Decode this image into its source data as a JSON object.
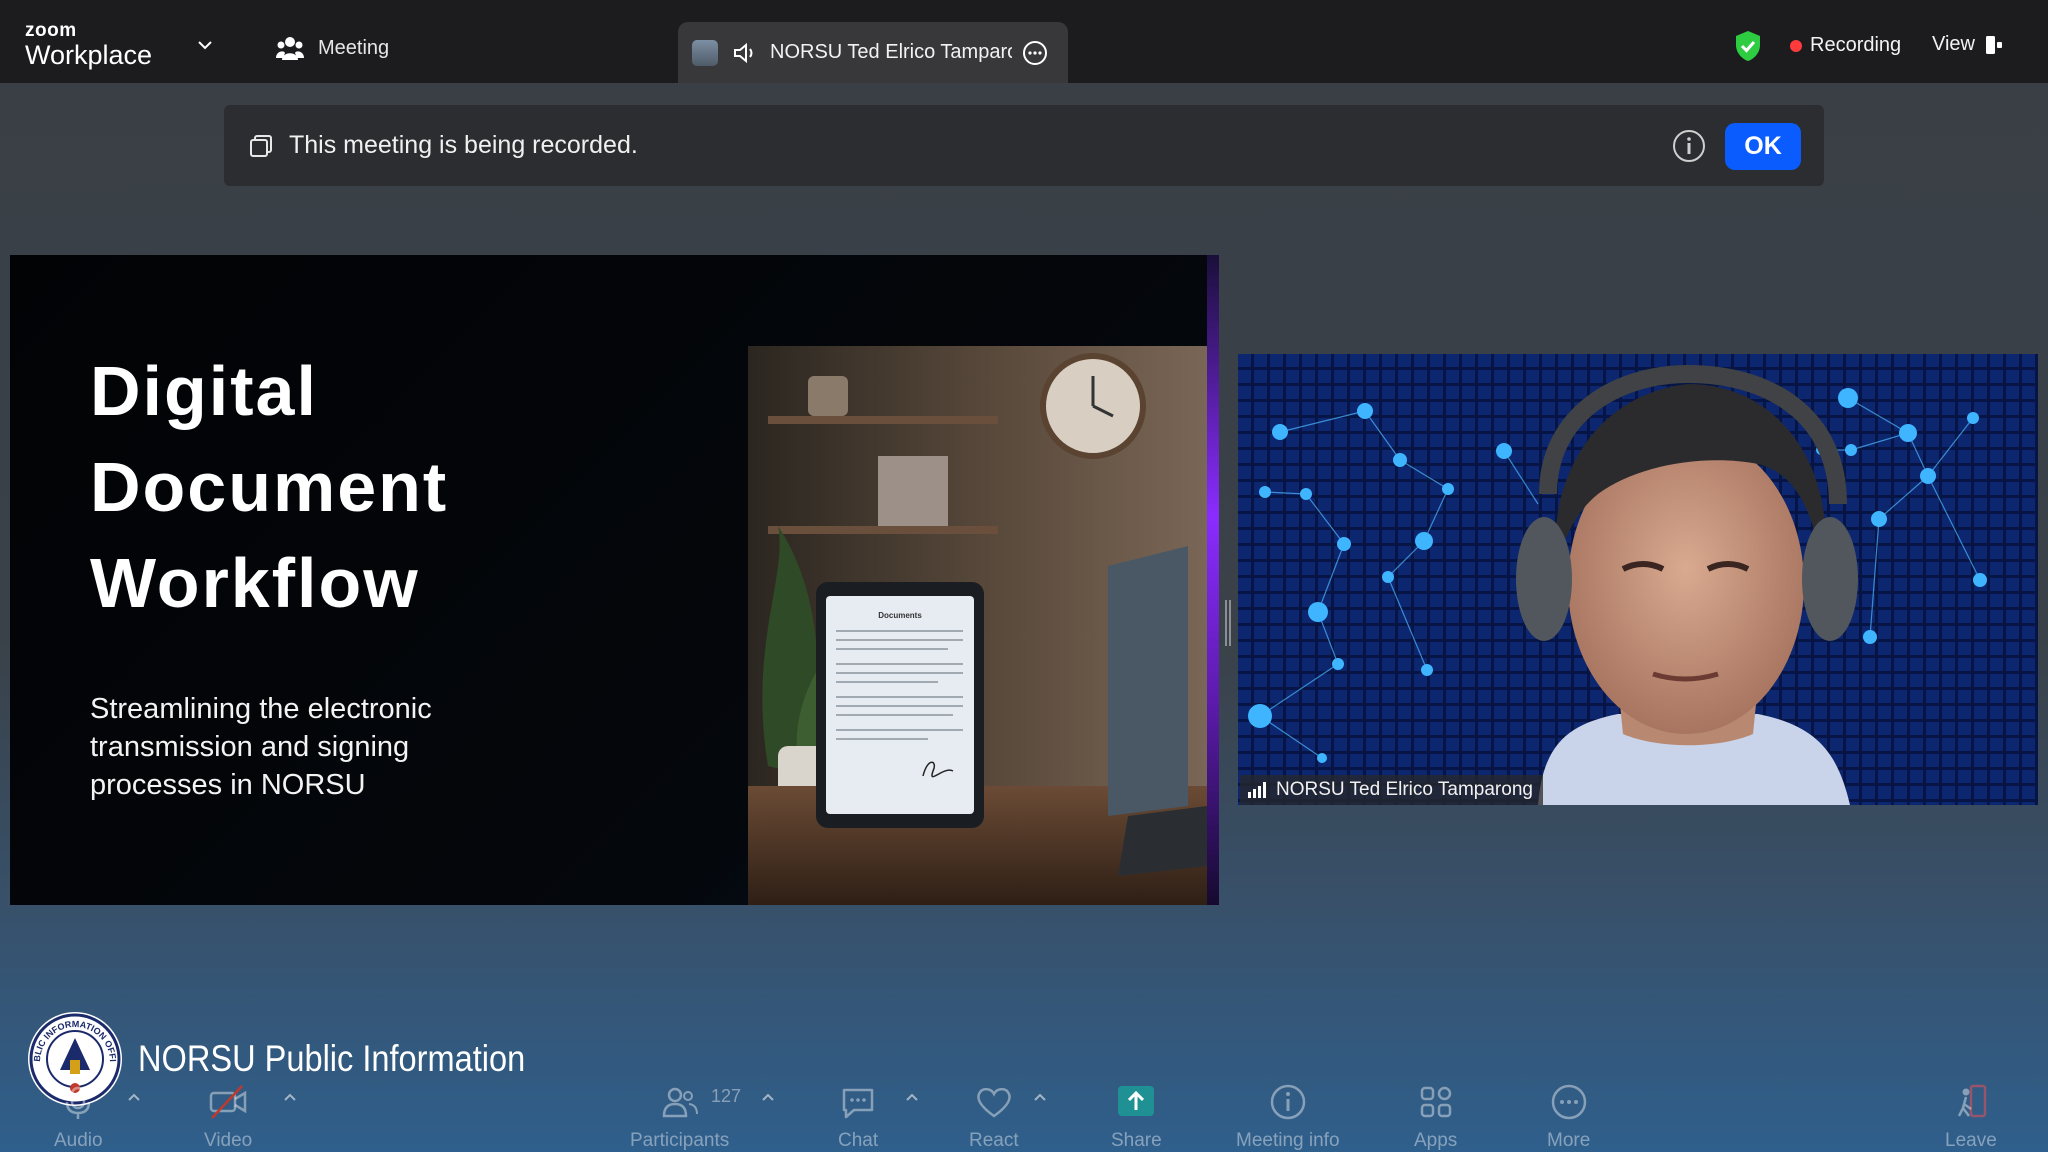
{
  "app": {
    "logo_top": "zoom",
    "logo_bottom": "Workplace"
  },
  "topbar": {
    "meeting_label": "Meeting",
    "speaker_name": "NORSU Ted Elrico Tamparong",
    "recording_label": "Recording",
    "view_label": "View"
  },
  "banner": {
    "message": "This meeting is being recorded.",
    "ok_label": "OK"
  },
  "slide": {
    "title_lines": [
      "Digital",
      "Document",
      "Workflow"
    ],
    "subtitle": "Streamlining the electronic transmission and signing processes in NORSU",
    "document_heading": "Documents"
  },
  "video": {
    "participant_name": "NORSU Ted Elrico Tamparong"
  },
  "organization": {
    "name": "NORSU Public Information",
    "seal_text": "PUBLIC INFORMATION OFFICE"
  },
  "toolbar": {
    "audio": "Audio",
    "video": "Video",
    "participants": "Participants",
    "participants_count": "127",
    "chat": "Chat",
    "react": "React",
    "share": "Share",
    "meeting_info": "Meeting info",
    "apps": "Apps",
    "more": "More",
    "leave": "Leave"
  },
  "colors": {
    "ok_button": "#0b5cff",
    "recording_dot": "#ff3b3b",
    "shield": "#2ecc40",
    "share_icon": "#1aa39a"
  }
}
